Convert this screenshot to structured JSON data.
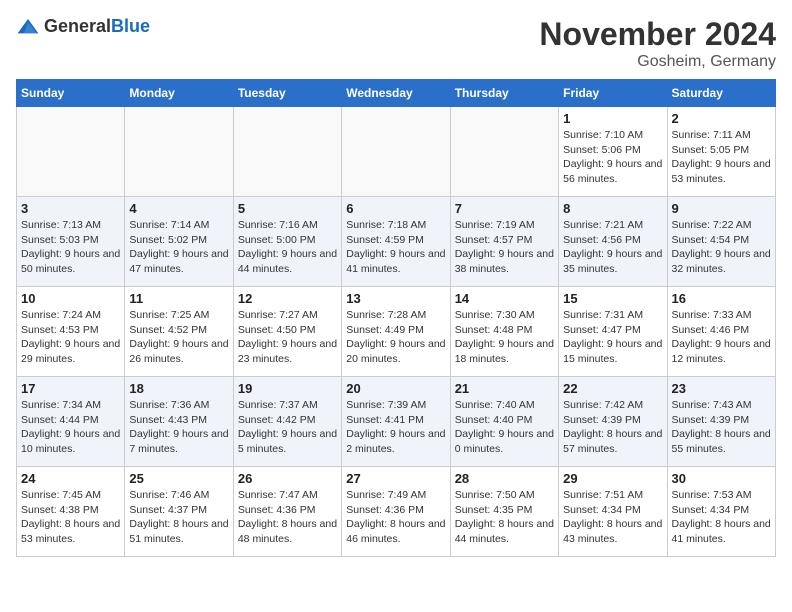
{
  "header": {
    "title": "November 2024",
    "subtitle": "Gosheim, Germany",
    "logo_general": "General",
    "logo_blue": "Blue"
  },
  "weekdays": [
    "Sunday",
    "Monday",
    "Tuesday",
    "Wednesday",
    "Thursday",
    "Friday",
    "Saturday"
  ],
  "weeks": [
    [
      {
        "day": "",
        "info": ""
      },
      {
        "day": "",
        "info": ""
      },
      {
        "day": "",
        "info": ""
      },
      {
        "day": "",
        "info": ""
      },
      {
        "day": "",
        "info": ""
      },
      {
        "day": "1",
        "info": "Sunrise: 7:10 AM\nSunset: 5:06 PM\nDaylight: 9 hours and 56 minutes."
      },
      {
        "day": "2",
        "info": "Sunrise: 7:11 AM\nSunset: 5:05 PM\nDaylight: 9 hours and 53 minutes."
      }
    ],
    [
      {
        "day": "3",
        "info": "Sunrise: 7:13 AM\nSunset: 5:03 PM\nDaylight: 9 hours and 50 minutes."
      },
      {
        "day": "4",
        "info": "Sunrise: 7:14 AM\nSunset: 5:02 PM\nDaylight: 9 hours and 47 minutes."
      },
      {
        "day": "5",
        "info": "Sunrise: 7:16 AM\nSunset: 5:00 PM\nDaylight: 9 hours and 44 minutes."
      },
      {
        "day": "6",
        "info": "Sunrise: 7:18 AM\nSunset: 4:59 PM\nDaylight: 9 hours and 41 minutes."
      },
      {
        "day": "7",
        "info": "Sunrise: 7:19 AM\nSunset: 4:57 PM\nDaylight: 9 hours and 38 minutes."
      },
      {
        "day": "8",
        "info": "Sunrise: 7:21 AM\nSunset: 4:56 PM\nDaylight: 9 hours and 35 minutes."
      },
      {
        "day": "9",
        "info": "Sunrise: 7:22 AM\nSunset: 4:54 PM\nDaylight: 9 hours and 32 minutes."
      }
    ],
    [
      {
        "day": "10",
        "info": "Sunrise: 7:24 AM\nSunset: 4:53 PM\nDaylight: 9 hours and 29 minutes."
      },
      {
        "day": "11",
        "info": "Sunrise: 7:25 AM\nSunset: 4:52 PM\nDaylight: 9 hours and 26 minutes."
      },
      {
        "day": "12",
        "info": "Sunrise: 7:27 AM\nSunset: 4:50 PM\nDaylight: 9 hours and 23 minutes."
      },
      {
        "day": "13",
        "info": "Sunrise: 7:28 AM\nSunset: 4:49 PM\nDaylight: 9 hours and 20 minutes."
      },
      {
        "day": "14",
        "info": "Sunrise: 7:30 AM\nSunset: 4:48 PM\nDaylight: 9 hours and 18 minutes."
      },
      {
        "day": "15",
        "info": "Sunrise: 7:31 AM\nSunset: 4:47 PM\nDaylight: 9 hours and 15 minutes."
      },
      {
        "day": "16",
        "info": "Sunrise: 7:33 AM\nSunset: 4:46 PM\nDaylight: 9 hours and 12 minutes."
      }
    ],
    [
      {
        "day": "17",
        "info": "Sunrise: 7:34 AM\nSunset: 4:44 PM\nDaylight: 9 hours and 10 minutes."
      },
      {
        "day": "18",
        "info": "Sunrise: 7:36 AM\nSunset: 4:43 PM\nDaylight: 9 hours and 7 minutes."
      },
      {
        "day": "19",
        "info": "Sunrise: 7:37 AM\nSunset: 4:42 PM\nDaylight: 9 hours and 5 minutes."
      },
      {
        "day": "20",
        "info": "Sunrise: 7:39 AM\nSunset: 4:41 PM\nDaylight: 9 hours and 2 minutes."
      },
      {
        "day": "21",
        "info": "Sunrise: 7:40 AM\nSunset: 4:40 PM\nDaylight: 9 hours and 0 minutes."
      },
      {
        "day": "22",
        "info": "Sunrise: 7:42 AM\nSunset: 4:39 PM\nDaylight: 8 hours and 57 minutes."
      },
      {
        "day": "23",
        "info": "Sunrise: 7:43 AM\nSunset: 4:39 PM\nDaylight: 8 hours and 55 minutes."
      }
    ],
    [
      {
        "day": "24",
        "info": "Sunrise: 7:45 AM\nSunset: 4:38 PM\nDaylight: 8 hours and 53 minutes."
      },
      {
        "day": "25",
        "info": "Sunrise: 7:46 AM\nSunset: 4:37 PM\nDaylight: 8 hours and 51 minutes."
      },
      {
        "day": "26",
        "info": "Sunrise: 7:47 AM\nSunset: 4:36 PM\nDaylight: 8 hours and 48 minutes."
      },
      {
        "day": "27",
        "info": "Sunrise: 7:49 AM\nSunset: 4:36 PM\nDaylight: 8 hours and 46 minutes."
      },
      {
        "day": "28",
        "info": "Sunrise: 7:50 AM\nSunset: 4:35 PM\nDaylight: 8 hours and 44 minutes."
      },
      {
        "day": "29",
        "info": "Sunrise: 7:51 AM\nSunset: 4:34 PM\nDaylight: 8 hours and 43 minutes."
      },
      {
        "day": "30",
        "info": "Sunrise: 7:53 AM\nSunset: 4:34 PM\nDaylight: 8 hours and 41 minutes."
      }
    ]
  ]
}
